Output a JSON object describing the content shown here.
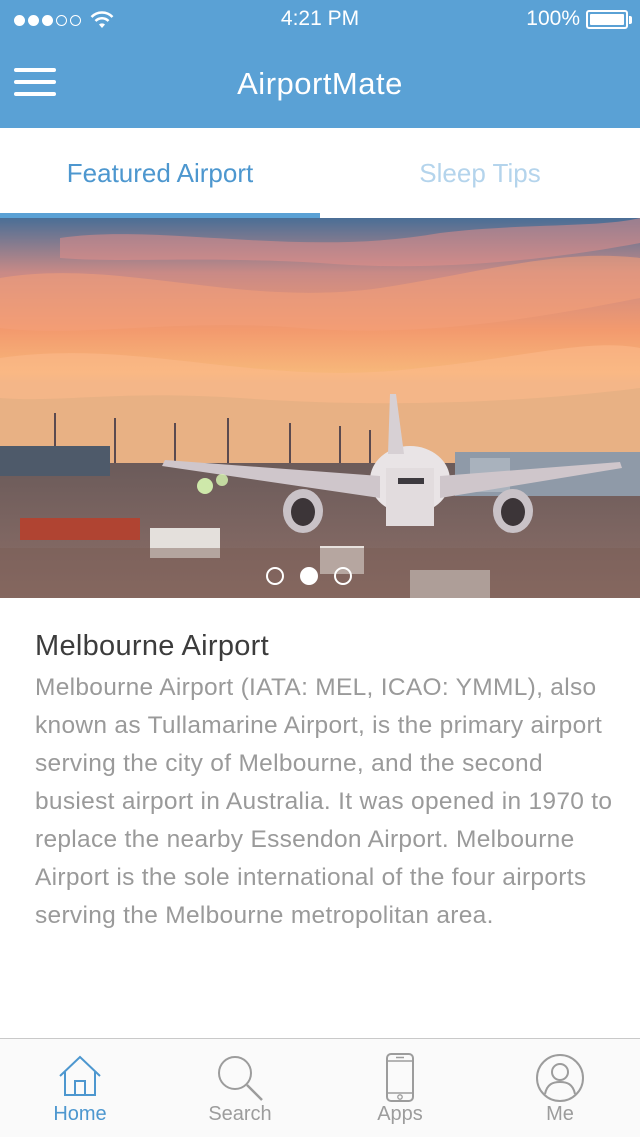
{
  "status_bar": {
    "time": "4:21 PM",
    "battery_percent": "100%",
    "signal_bars_filled": 3,
    "signal_bars_total": 5
  },
  "header": {
    "title": "AirportMate",
    "menu_icon": "hamburger-menu-icon",
    "background_color": "#5aa1d5"
  },
  "tabs": [
    {
      "label": "Featured Airport",
      "active": true
    },
    {
      "label": "Sleep Tips",
      "active": false
    }
  ],
  "carousel": {
    "page_count": 3,
    "current_page": 2
  },
  "article": {
    "title": "Melbourne Airport",
    "body": "Melbourne Airport (IATA: MEL, ICAO: YMML), also known as Tullamarine Airport, is the primary airport serving the city of Melbourne, and the second busiest airport in Australia. It was opened in 1970 to replace the nearby Essendon Airport. Melbourne Airport is the sole international of the four airports serving the Melbourne metropolitan area."
  },
  "bottom_nav": [
    {
      "label": "Home",
      "icon": "home-icon",
      "active": true
    },
    {
      "label": "Search",
      "icon": "search-icon",
      "active": false
    },
    {
      "label": "Apps",
      "icon": "phone-icon",
      "active": false
    },
    {
      "label": "Me",
      "icon": "user-icon",
      "active": false
    }
  ],
  "colors": {
    "accent": "#4d97cf",
    "inactive_tab": "#b4d4ec",
    "body_text": "#9a9a9a"
  }
}
